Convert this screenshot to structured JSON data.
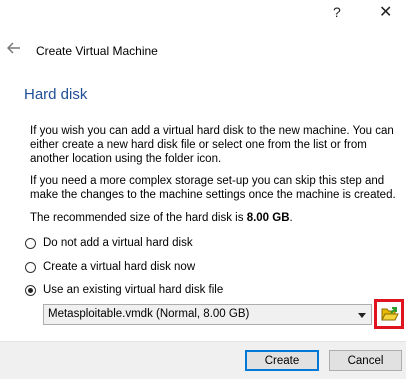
{
  "window": {
    "help_glyph": "?",
    "close_glyph": "✕"
  },
  "header": {
    "title": "Create Virtual Machine"
  },
  "page": {
    "title": "Hard disk",
    "para1": "If you wish you can add a virtual hard disk to the new machine. You can either create a new hard disk file or select one from the list or from another location using the folder icon.",
    "para2": "If you need a more complex storage set-up you can skip this step and make the changes to the machine settings once the machine is created.",
    "recommended_prefix": "The recommended size of the hard disk is ",
    "recommended_size": "8.00 GB",
    "recommended_suffix": "."
  },
  "options": [
    {
      "label": "Do not add a virtual hard disk",
      "checked": false
    },
    {
      "label": "Create a virtual hard disk now",
      "checked": false
    },
    {
      "label": "Use an existing virtual hard disk file",
      "checked": true
    }
  ],
  "disk_select": {
    "value": "Metasploitable.vmdk (Normal, 8.00 GB)"
  },
  "icons": {
    "back": "arrow-left-icon",
    "folder": "folder-open-icon",
    "dropdown": "chevron-down-icon"
  },
  "colors": {
    "title_blue": "#1f4e96",
    "highlight_red": "#e0141e",
    "default_button_border": "#0078d7"
  },
  "buttons": {
    "create": "Create",
    "cancel": "Cancel"
  }
}
